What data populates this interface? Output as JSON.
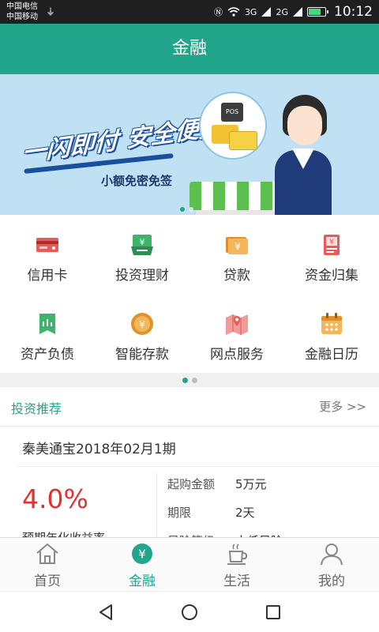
{
  "status_bar": {
    "carrier1": "中国电信",
    "carrier2": "中国移动",
    "net1": "3G",
    "net2": "2G",
    "time": "10:12"
  },
  "header": {
    "title": "金融"
  },
  "banner": {
    "slogan": "一闪即付 安全便捷",
    "subtitle": "小额免密免签",
    "pos_text": "POS"
  },
  "grid": {
    "items": [
      {
        "label": "信用卡",
        "icon": "credit-card-icon"
      },
      {
        "label": "投资理财",
        "icon": "investment-icon"
      },
      {
        "label": "贷款",
        "icon": "loan-icon"
      },
      {
        "label": "资金归集",
        "icon": "fund-collect-icon"
      },
      {
        "label": "资产负债",
        "icon": "assets-icon"
      },
      {
        "label": "智能存款",
        "icon": "smart-deposit-icon"
      },
      {
        "label": "网点服务",
        "icon": "branch-map-icon"
      },
      {
        "label": "金融日历",
        "icon": "calendar-icon"
      }
    ]
  },
  "recommend": {
    "title": "投资推荐",
    "more": "更多 >>",
    "product": {
      "name": "秦美通宝2018年02月1期",
      "rate": "4.0%",
      "rate_label": "预期年化收益率",
      "rows": [
        {
          "key": "起购金额",
          "value": "5万元"
        },
        {
          "key": "期限",
          "value": "2天"
        },
        {
          "key": "风险等级",
          "value": "中低风险"
        }
      ]
    }
  },
  "tabbar": {
    "tabs": [
      {
        "label": "首页",
        "icon": "home-icon"
      },
      {
        "label": "金融",
        "icon": "yuan-coin-icon"
      },
      {
        "label": "生活",
        "icon": "coffee-cup-icon"
      },
      {
        "label": "我的",
        "icon": "user-icon"
      }
    ],
    "active": "金融"
  },
  "colors": {
    "brand": "#21a68b",
    "rate_red": "#e2312f",
    "status_bar": "#1f1f1f"
  }
}
